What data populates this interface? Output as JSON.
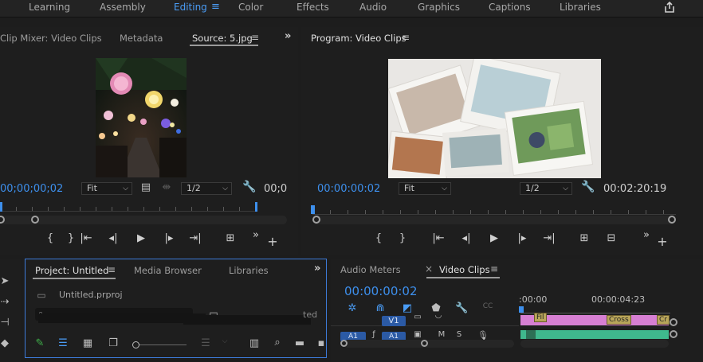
{
  "workspaces": {
    "items": [
      "Learning",
      "Assembly",
      "Editing",
      "Color",
      "Effects",
      "Audio",
      "Graphics",
      "Captions",
      "Libraries"
    ],
    "active": "Editing"
  },
  "source_panel": {
    "tabs": [
      "Clip Mixer: Video Clips",
      "Metadata",
      "Source: 5.jpg"
    ],
    "active_tab": "Source: 5.jpg",
    "timecode_left": "00;00;00;02",
    "timecode_right": "00;0",
    "fit": "Fit",
    "resolution": "1/2"
  },
  "program_panel": {
    "title": "Program: Video Clips",
    "timecode_left": "00:00:00:02",
    "timecode_right": "00:02:20:19",
    "fit": "Fit",
    "resolution": "1/2"
  },
  "project_panel": {
    "tabs": [
      "Project: Untitled",
      "Media Browser",
      "Libraries"
    ],
    "active_tab": "Project: Untitled",
    "file_name": "Untitled.prproj",
    "count_text": "ted"
  },
  "timeline_panel": {
    "tabs": [
      "Audio Meters",
      "Video Clips"
    ],
    "active_tab": "Video Clips",
    "timecode": "00:00:00:02",
    "ruler_start": ":00:00",
    "ruler_mark": "00:00:04:23",
    "track_v1": "V1",
    "track_a1": "A1",
    "clip_label_1": "Cross",
    "clip_label_2": "Cr",
    "clip_label_3": "Fil"
  },
  "colors": {
    "accent_blue": "#3d8fec",
    "panel_bg": "#1e1e1e",
    "clip_video": "#d77fd3",
    "clip_audio": "#3fb88d"
  }
}
